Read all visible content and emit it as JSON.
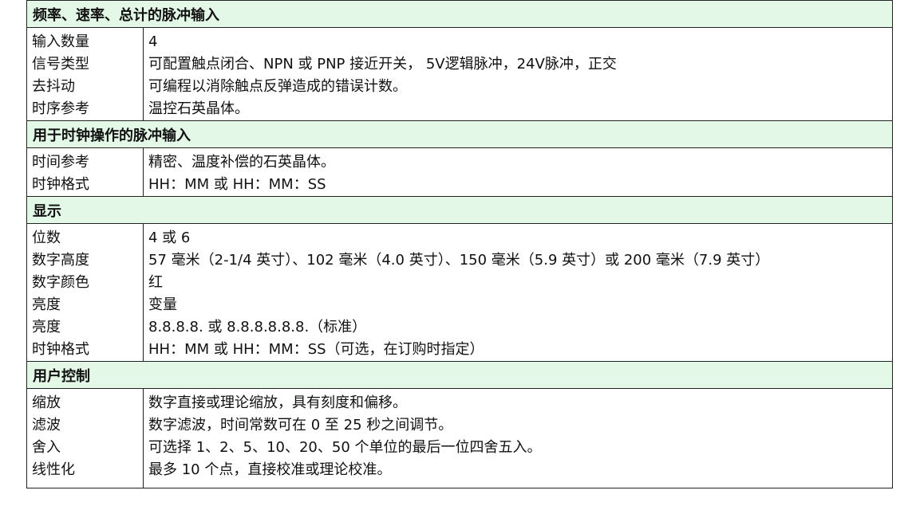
{
  "sections": [
    {
      "title": "频率、速率、总计的脉冲输入",
      "rows": [
        {
          "label": "输入数量",
          "value": "4"
        },
        {
          "label": "信号类型",
          "value": "可配置触点闭合、NPN 或 PNP 接近开关， 5V逻辑脉冲，24V脉冲，正交"
        },
        {
          "label": "去抖动",
          "value": "可编程以消除触点反弹造成的错误计数。"
        },
        {
          "label": "时序参考",
          "value": "温控石英晶体。"
        }
      ]
    },
    {
      "title": "用于时钟操作的脉冲输入",
      "rows": [
        {
          "label": "时间参考",
          "value": "精密、温度补偿的石英晶体。"
        },
        {
          "label": "时钟格式",
          "value": "HH：MM 或 HH：MM：SS"
        }
      ]
    },
    {
      "title": "显示",
      "rows": [
        {
          "label": "位数",
          "value": "4 或 6"
        },
        {
          "label": "数字高度",
          "value": "57 毫米（2-1/4 英寸）、102 毫米（4.0 英寸）、150 毫米（5.9 英寸）或 200 毫米（7.9 英寸）"
        },
        {
          "label": "数字颜色",
          "value": "红"
        },
        {
          "label": "亮度",
          "value": "变量"
        },
        {
          "label": "亮度",
          "value": "8.8.8.8. 或 8.8.8.8.8.8.（标准）"
        },
        {
          "label": "时钟格式",
          "value": "HH：MM 或 HH：MM：SS（可选，在订购时指定）"
        }
      ]
    },
    {
      "title": "用户控制",
      "rows": [
        {
          "label": "缩放",
          "value": "数字直接或理论缩放，具有刻度和偏移。"
        },
        {
          "label": "滤波",
          "value": "数字滤波，时间常数可在 0 至 25 秒之间调节。"
        },
        {
          "label": "舍入",
          "value": "可选择 1、2、5、10、20、50 个单位的最后一位四舍五入。"
        },
        {
          "label": "线性化",
          "value": "最多 10 个点，直接校准或理论校准。"
        }
      ]
    }
  ],
  "colors": {
    "header_bg": "#e3f8e6",
    "border": "#222222"
  }
}
